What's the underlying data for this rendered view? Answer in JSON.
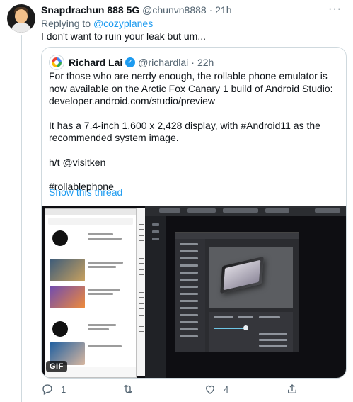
{
  "author": {
    "name": "Snapdrachun 888 5G",
    "handle": "@chunvn8888",
    "separator": "·",
    "time": "21h"
  },
  "reply": {
    "prefix": "Replying to",
    "mention": "@cozyplanes"
  },
  "tweet_text": "I don't want to ruin your leak but um...",
  "quote": {
    "name": "Richard Lai",
    "handle": "@richardlai",
    "separator": "·",
    "time": "22h",
    "paragraphs": [
      "For those who are nerdy enough, the rollable phone emulator is now available on the Arctic Fox Canary 1 build of Android Studio: developer.android.com/studio/preview",
      "It has a 7.4-inch 1,600 x 2,428 display, with #Android11 as the recommended system image.",
      "h/t @visitken",
      "#rollablephone"
    ],
    "show_thread": "Show this thread"
  },
  "media": {
    "badge": "GIF"
  },
  "actions": {
    "reply_icon": "reply-icon",
    "reply_count": "1",
    "retweet_icon": "retweet-icon",
    "retweet_count": "",
    "like_icon": "heart-icon",
    "like_count": "4",
    "share_icon": "share-icon"
  },
  "colors": {
    "accent": "#1d9bf0",
    "muted_text": "#536471",
    "border": "#cfd9de"
  }
}
